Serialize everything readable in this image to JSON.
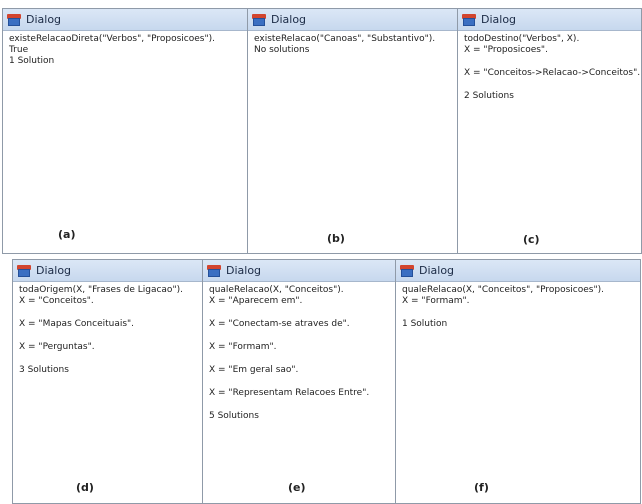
{
  "dialog_title": "Dialog",
  "panels": {
    "a": {
      "label": "(a)",
      "lines": [
        "existeRelacaoDireta(\"Verbos\", \"Proposicoes\").",
        "True",
        "1 Solution"
      ]
    },
    "b": {
      "label": "(b)",
      "lines": [
        "existeRelacao(\"Canoas\", \"Substantivo\").",
        "No solutions"
      ]
    },
    "c": {
      "label": "(c)",
      "lines": [
        "todoDestino(\"Verbos\", X).",
        "X = \"Proposicoes\".",
        "X = \"Conceitos->Relacao->Conceitos\".",
        "2 Solutions"
      ]
    },
    "d": {
      "label": "(d)",
      "lines": [
        "todaOrigem(X, \"Frases de Ligacao\").",
        "X = \"Conceitos\".",
        "X = \"Mapas Conceituais\".",
        "X = \"Perguntas\".",
        "3 Solutions"
      ]
    },
    "e": {
      "label": "(e)",
      "lines": [
        "qualeRelacao(X, \"Conceitos\").",
        "X = \"Aparecem em\".",
        "X = \"Conectam-se atraves de\".",
        "X = \"Formam\".",
        "X = \"Em geral sao\".",
        "X = \"Representam Relacoes Entre\".",
        "5 Solutions"
      ]
    },
    "f": {
      "label": "(f)",
      "lines": [
        "qualeRelacao(X, \"Conceitos\", \"Proposicoes\").",
        "X = \"Formam\".",
        "1 Solution"
      ]
    }
  }
}
